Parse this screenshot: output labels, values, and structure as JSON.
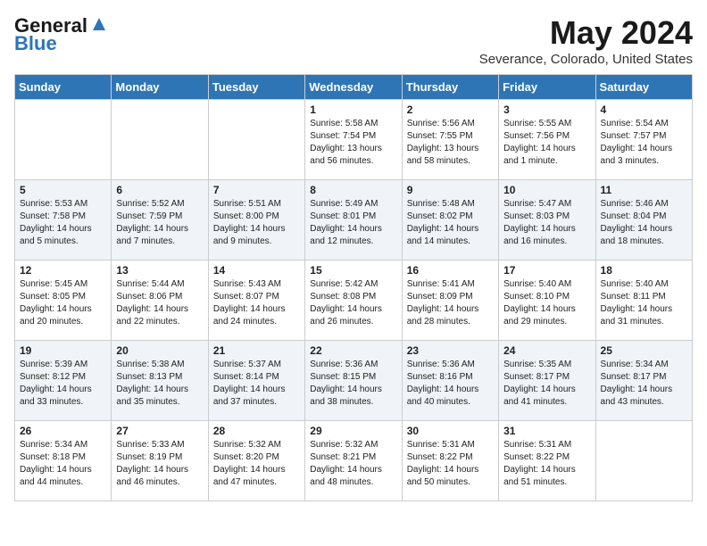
{
  "header": {
    "logo_line1": "General",
    "logo_line2": "Blue",
    "month": "May 2024",
    "location": "Severance, Colorado, United States"
  },
  "days_of_week": [
    "Sunday",
    "Monday",
    "Tuesday",
    "Wednesday",
    "Thursday",
    "Friday",
    "Saturday"
  ],
  "weeks": [
    [
      {
        "day": "",
        "content": ""
      },
      {
        "day": "",
        "content": ""
      },
      {
        "day": "",
        "content": ""
      },
      {
        "day": "1",
        "content": "Sunrise: 5:58 AM\nSunset: 7:54 PM\nDaylight: 13 hours\nand 56 minutes."
      },
      {
        "day": "2",
        "content": "Sunrise: 5:56 AM\nSunset: 7:55 PM\nDaylight: 13 hours\nand 58 minutes."
      },
      {
        "day": "3",
        "content": "Sunrise: 5:55 AM\nSunset: 7:56 PM\nDaylight: 14 hours\nand 1 minute."
      },
      {
        "day": "4",
        "content": "Sunrise: 5:54 AM\nSunset: 7:57 PM\nDaylight: 14 hours\nand 3 minutes."
      }
    ],
    [
      {
        "day": "5",
        "content": "Sunrise: 5:53 AM\nSunset: 7:58 PM\nDaylight: 14 hours\nand 5 minutes."
      },
      {
        "day": "6",
        "content": "Sunrise: 5:52 AM\nSunset: 7:59 PM\nDaylight: 14 hours\nand 7 minutes."
      },
      {
        "day": "7",
        "content": "Sunrise: 5:51 AM\nSunset: 8:00 PM\nDaylight: 14 hours\nand 9 minutes."
      },
      {
        "day": "8",
        "content": "Sunrise: 5:49 AM\nSunset: 8:01 PM\nDaylight: 14 hours\nand 12 minutes."
      },
      {
        "day": "9",
        "content": "Sunrise: 5:48 AM\nSunset: 8:02 PM\nDaylight: 14 hours\nand 14 minutes."
      },
      {
        "day": "10",
        "content": "Sunrise: 5:47 AM\nSunset: 8:03 PM\nDaylight: 14 hours\nand 16 minutes."
      },
      {
        "day": "11",
        "content": "Sunrise: 5:46 AM\nSunset: 8:04 PM\nDaylight: 14 hours\nand 18 minutes."
      }
    ],
    [
      {
        "day": "12",
        "content": "Sunrise: 5:45 AM\nSunset: 8:05 PM\nDaylight: 14 hours\nand 20 minutes."
      },
      {
        "day": "13",
        "content": "Sunrise: 5:44 AM\nSunset: 8:06 PM\nDaylight: 14 hours\nand 22 minutes."
      },
      {
        "day": "14",
        "content": "Sunrise: 5:43 AM\nSunset: 8:07 PM\nDaylight: 14 hours\nand 24 minutes."
      },
      {
        "day": "15",
        "content": "Sunrise: 5:42 AM\nSunset: 8:08 PM\nDaylight: 14 hours\nand 26 minutes."
      },
      {
        "day": "16",
        "content": "Sunrise: 5:41 AM\nSunset: 8:09 PM\nDaylight: 14 hours\nand 28 minutes."
      },
      {
        "day": "17",
        "content": "Sunrise: 5:40 AM\nSunset: 8:10 PM\nDaylight: 14 hours\nand 29 minutes."
      },
      {
        "day": "18",
        "content": "Sunrise: 5:40 AM\nSunset: 8:11 PM\nDaylight: 14 hours\nand 31 minutes."
      }
    ],
    [
      {
        "day": "19",
        "content": "Sunrise: 5:39 AM\nSunset: 8:12 PM\nDaylight: 14 hours\nand 33 minutes."
      },
      {
        "day": "20",
        "content": "Sunrise: 5:38 AM\nSunset: 8:13 PM\nDaylight: 14 hours\nand 35 minutes."
      },
      {
        "day": "21",
        "content": "Sunrise: 5:37 AM\nSunset: 8:14 PM\nDaylight: 14 hours\nand 37 minutes."
      },
      {
        "day": "22",
        "content": "Sunrise: 5:36 AM\nSunset: 8:15 PM\nDaylight: 14 hours\nand 38 minutes."
      },
      {
        "day": "23",
        "content": "Sunrise: 5:36 AM\nSunset: 8:16 PM\nDaylight: 14 hours\nand 40 minutes."
      },
      {
        "day": "24",
        "content": "Sunrise: 5:35 AM\nSunset: 8:17 PM\nDaylight: 14 hours\nand 41 minutes."
      },
      {
        "day": "25",
        "content": "Sunrise: 5:34 AM\nSunset: 8:17 PM\nDaylight: 14 hours\nand 43 minutes."
      }
    ],
    [
      {
        "day": "26",
        "content": "Sunrise: 5:34 AM\nSunset: 8:18 PM\nDaylight: 14 hours\nand 44 minutes."
      },
      {
        "day": "27",
        "content": "Sunrise: 5:33 AM\nSunset: 8:19 PM\nDaylight: 14 hours\nand 46 minutes."
      },
      {
        "day": "28",
        "content": "Sunrise: 5:32 AM\nSunset: 8:20 PM\nDaylight: 14 hours\nand 47 minutes."
      },
      {
        "day": "29",
        "content": "Sunrise: 5:32 AM\nSunset: 8:21 PM\nDaylight: 14 hours\nand 48 minutes."
      },
      {
        "day": "30",
        "content": "Sunrise: 5:31 AM\nSunset: 8:22 PM\nDaylight: 14 hours\nand 50 minutes."
      },
      {
        "day": "31",
        "content": "Sunrise: 5:31 AM\nSunset: 8:22 PM\nDaylight: 14 hours\nand 51 minutes."
      },
      {
        "day": "",
        "content": ""
      }
    ]
  ]
}
